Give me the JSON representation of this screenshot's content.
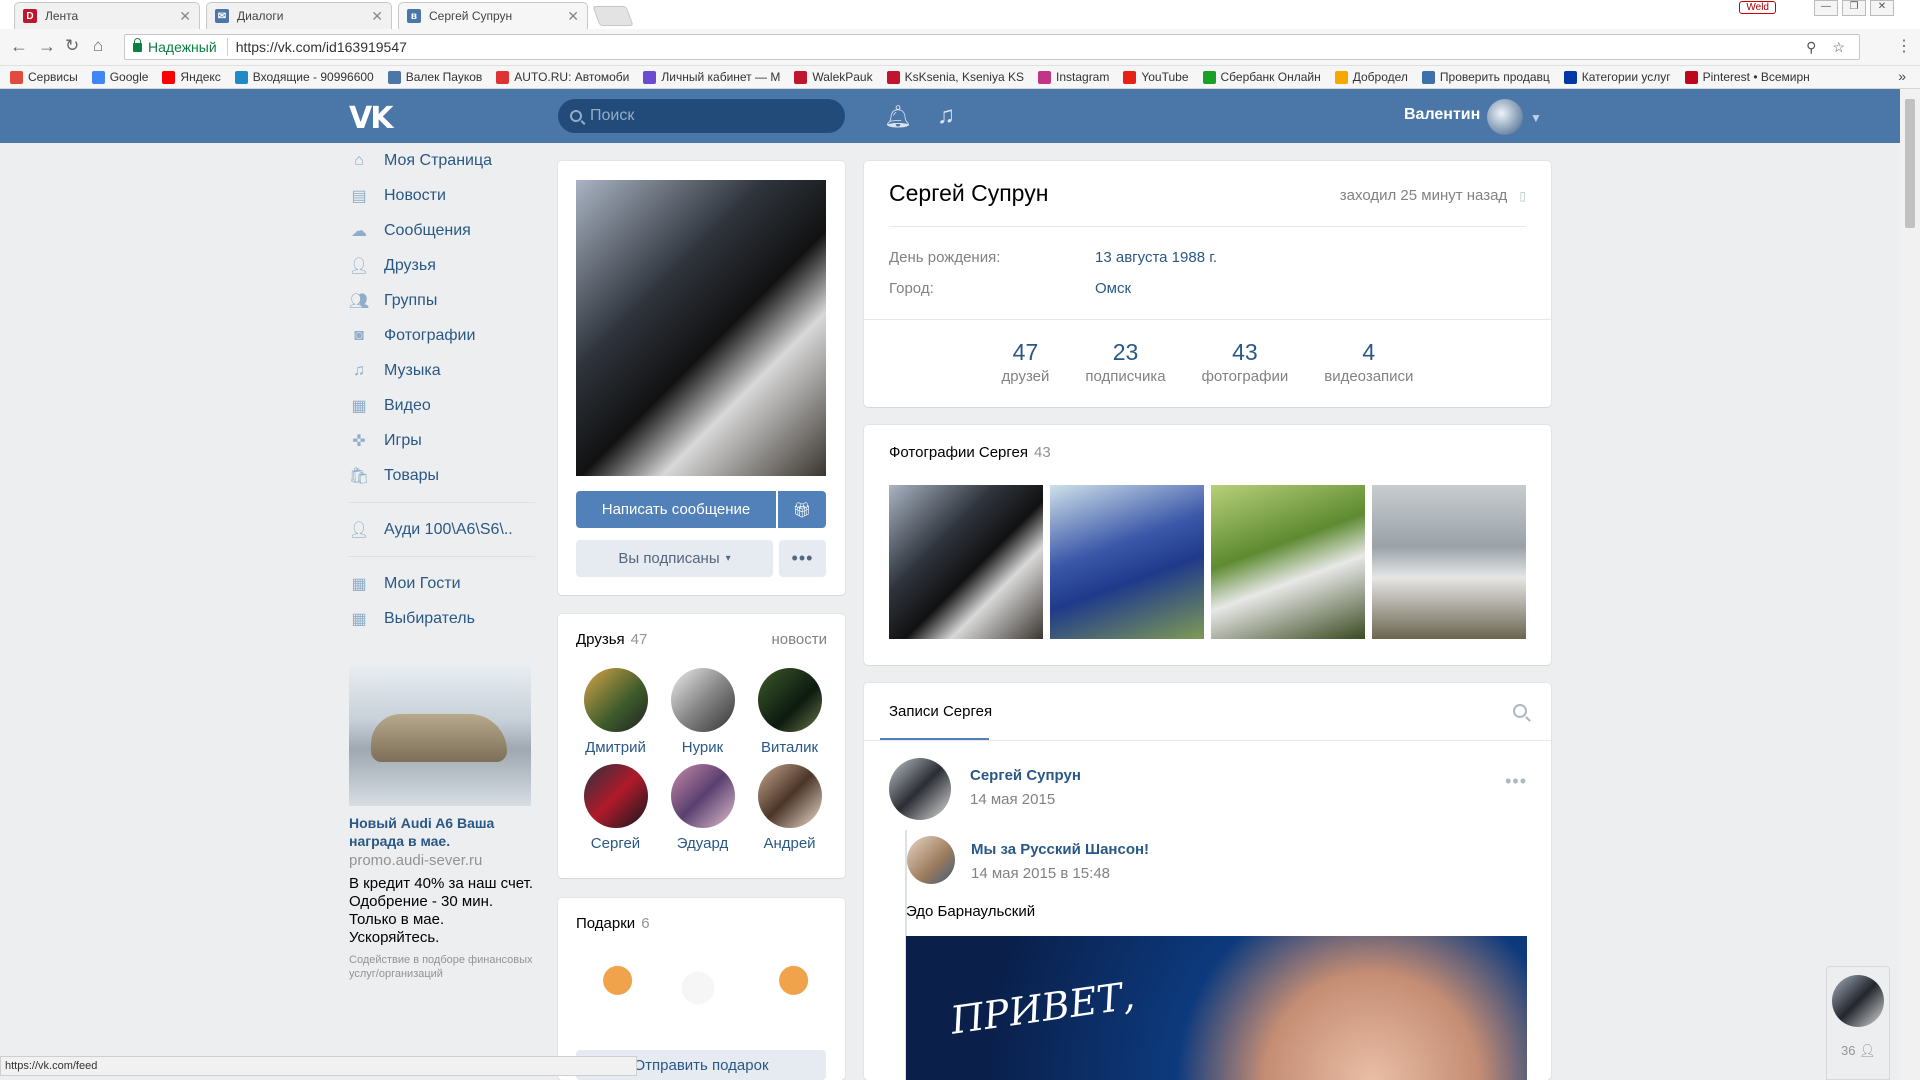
{
  "browser": {
    "tabs": [
      {
        "label": "Лента",
        "icon": "d-favicon",
        "color": "#c0152f"
      },
      {
        "label": "Диалоги",
        "icon": "vk-dialogs-favicon",
        "color": "#4a76a8"
      },
      {
        "label": "Сергей Супрун",
        "icon": "vk-favicon",
        "color": "#4a76a8"
      }
    ],
    "weld_label": "Weld",
    "secure_label": "Надежный",
    "url": "https://vk.com/id163919547",
    "bookmarks": [
      {
        "label": "Сервисы",
        "color": "#e24a3d"
      },
      {
        "label": "Google",
        "color": "#4285f4"
      },
      {
        "label": "Яндекс",
        "color": "#f00"
      },
      {
        "label": "Входящие - 90996600",
        "color": "#1f8ac5"
      },
      {
        "label": "Валек Пауков",
        "color": "#4a76a8"
      },
      {
        "label": "AUTO.RU: Автомоби",
        "color": "#d33"
      },
      {
        "label": "Личный кабинет — М",
        "color": "#6b4bd0"
      },
      {
        "label": "WalekPauk",
        "color": "#c0152f"
      },
      {
        "label": "KsKsenia, Kseniya KS",
        "color": "#c0152f"
      },
      {
        "label": "Instagram",
        "color": "#c13584"
      },
      {
        "label": "YouTube",
        "color": "#e62117"
      },
      {
        "label": "Сбербанк Онлайн",
        "color": "#1a9f29"
      },
      {
        "label": "Добродел",
        "color": "#f7a800"
      },
      {
        "label": "Проверить продавц",
        "color": "#3d6fa8"
      },
      {
        "label": "Категории услуг",
        "color": "#0039a6"
      },
      {
        "label": "Pinterest • Всемирн",
        "color": "#bd081c"
      }
    ],
    "status_url": "https://vk.com/feed"
  },
  "vk_header": {
    "logo": "VK",
    "search_placeholder": "Поиск",
    "username": "Валентин"
  },
  "sidebar": {
    "items": [
      {
        "label": "Моя Страница",
        "icon": "home-icon"
      },
      {
        "label": "Новости",
        "icon": "news-icon"
      },
      {
        "label": "Сообщения",
        "icon": "messages-icon"
      },
      {
        "label": "Друзья",
        "icon": "friends-icon"
      },
      {
        "label": "Группы",
        "icon": "groups-icon"
      },
      {
        "label": "Фотографии",
        "icon": "camera-icon"
      },
      {
        "label": "Музыка",
        "icon": "music-icon"
      },
      {
        "label": "Видео",
        "icon": "video-icon"
      },
      {
        "label": "Игры",
        "icon": "gamepad-icon"
      },
      {
        "label": "Товары",
        "icon": "bag-icon"
      }
    ],
    "groups_items": [
      {
        "label": "Ауди 100\\A6\\S6\\..",
        "icon": "friends-icon"
      }
    ],
    "apps_items": [
      {
        "label": "Мои Гости",
        "icon": "app-grid-icon"
      },
      {
        "label": "Выбиратель",
        "icon": "app-grid-icon"
      }
    ],
    "ad": {
      "title": "Новый Audi A6 Ваша награда в мае.",
      "url": "promo.audi-sever.ru",
      "text": "В кредит 40% за наш счет. Одобрение - 30 мин. Только в мае. Ускоряйтесь.",
      "small": "Содействие в подборе финансовых услуг/организаций"
    }
  },
  "profile": {
    "name": "Сергей Супрун",
    "online": "заходил 25 минут назад",
    "birthday_label": "День рождения:",
    "birthday": "13 августа 1988 г.",
    "city_label": "Город:",
    "city": "Омск",
    "counters": [
      {
        "n": "47",
        "label": "друзей"
      },
      {
        "n": "23",
        "label": "подписчика"
      },
      {
        "n": "43",
        "label": "фотографии"
      },
      {
        "n": "4",
        "label": "видеозаписи"
      }
    ],
    "write_button": "Написать сообщение",
    "subscribed_button": "Вы подписаны"
  },
  "friends_block": {
    "title": "Друзья",
    "count": "47",
    "news_link": "новости",
    "friends": [
      {
        "name": "Дмитрий"
      },
      {
        "name": "Нурик"
      },
      {
        "name": "Виталик"
      },
      {
        "name": "Сергей"
      },
      {
        "name": "Эдуард"
      },
      {
        "name": "Андрей"
      }
    ]
  },
  "gifts_block": {
    "title": "Подарки",
    "count": "6",
    "send_button": "Отправить подарок"
  },
  "photos_block": {
    "title": "Фотографии Сергея",
    "count": "43"
  },
  "wall": {
    "tab": "Записи Сергея",
    "post": {
      "author": "Сергей Супрун",
      "date": "14 мая 2015",
      "repost_author": "Мы за Русский Шансон!",
      "repost_date": "14 мая 2015 в 15:48",
      "repost_text": "Эдо Барнаульский",
      "image_text": "ПРИВЕТ,"
    }
  },
  "chat_widget": {
    "count": "36"
  }
}
